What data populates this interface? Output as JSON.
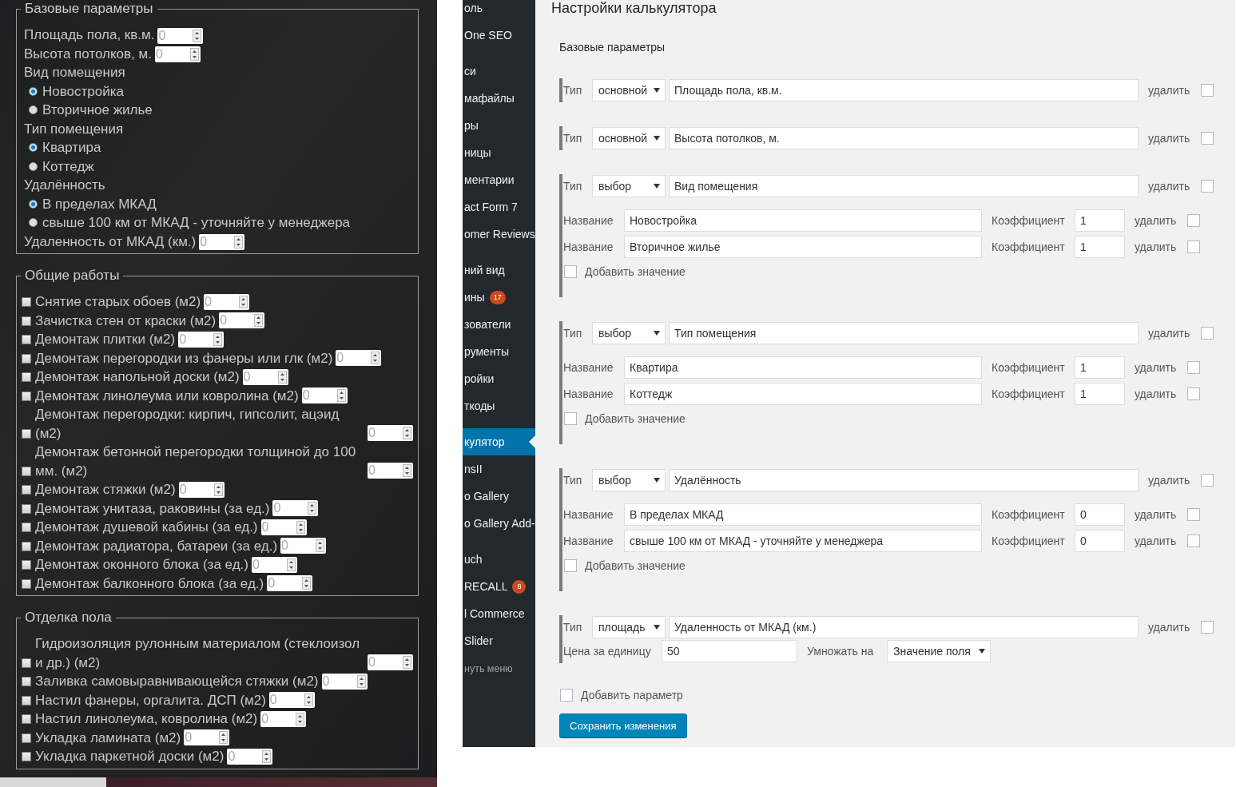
{
  "calculator_form": {
    "sections": [
      {
        "legend": "Базовые параметры",
        "items": [
          {
            "kind": "number",
            "label": "Площадь пола, кв.м.",
            "value": "0"
          },
          {
            "kind": "number",
            "label": "Высота потолков, м.",
            "value": "0"
          },
          {
            "kind": "heading",
            "label": "Вид помещения"
          },
          {
            "kind": "radio",
            "label": "Новостройка",
            "selected": true
          },
          {
            "kind": "radio",
            "label": "Вторичное жилье",
            "selected": false
          },
          {
            "kind": "heading",
            "label": "Тип помещения"
          },
          {
            "kind": "radio",
            "label": "Квартира",
            "selected": true
          },
          {
            "kind": "radio",
            "label": "Коттедж",
            "selected": false
          },
          {
            "kind": "heading",
            "label": "Удалённость"
          },
          {
            "kind": "radio",
            "label": "В пределах МКАД",
            "selected": true
          },
          {
            "kind": "radio",
            "label": "свыше 100 км от МКАД - уточняйте у менеджера",
            "selected": false
          },
          {
            "kind": "number",
            "label": "Удаленность от МКАД (км.)",
            "value": "0"
          }
        ]
      },
      {
        "legend": "Общие работы",
        "items": [
          {
            "kind": "check",
            "label": "Снятие старых обоев (м2)",
            "checked": false,
            "value": "0"
          },
          {
            "kind": "check",
            "label": "Зачистка стен от краски (м2)",
            "checked": false,
            "value": "0"
          },
          {
            "kind": "check",
            "label": "Демонтаж плитки (м2)",
            "checked": false,
            "value": "0"
          },
          {
            "kind": "check",
            "label": "Демонтаж перегородки из фанеры или глк (м2)",
            "checked": false,
            "value": "0"
          },
          {
            "kind": "check",
            "label": "Демонтаж напольной доски (м2)",
            "checked": false,
            "value": "0"
          },
          {
            "kind": "check",
            "label": "Демонтаж линолеума или ковролина (м2)",
            "checked": false,
            "value": "0"
          },
          {
            "kind": "check",
            "label": "Демонтаж перегородки: кирпич, гипсолит, ацэид (м2)",
            "checked": false,
            "value": "0"
          },
          {
            "kind": "check",
            "label": "Демонтаж бетонной перегородки толщиной до 100 мм. (м2)",
            "checked": false,
            "value": "0"
          },
          {
            "kind": "check",
            "label": "Демонтаж стяжки (м2)",
            "checked": false,
            "value": "0"
          },
          {
            "kind": "check",
            "label": "Демонтаж унитаза, раковины (за ед.)",
            "checked": false,
            "value": "0"
          },
          {
            "kind": "check",
            "label": "Демонтаж душевой кабины (за ед.)",
            "checked": false,
            "value": "0"
          },
          {
            "kind": "check",
            "label": "Демонтаж радиатора, батареи (за ед.)",
            "checked": false,
            "value": "0"
          },
          {
            "kind": "check",
            "label": "Демонтаж оконного блока (за ед.)",
            "checked": false,
            "value": "0"
          },
          {
            "kind": "check",
            "label": "Демонтаж балконного блока (за ед.)",
            "checked": false,
            "value": "0"
          }
        ]
      },
      {
        "legend": "Отделка пола",
        "items": [
          {
            "kind": "check",
            "label": "Гидроизоляция рулонным материалом (стеклоизол и др.) (м2)",
            "checked": false,
            "value": "0"
          },
          {
            "kind": "check",
            "label": "Заливка самовыравнивающейся стяжки (м2)",
            "checked": false,
            "value": "0"
          },
          {
            "kind": "check",
            "label": "Настил фанеры, оргалита. ДСП (м2)",
            "checked": false,
            "value": "0"
          },
          {
            "kind": "check",
            "label": "Настил линолеума, ковролина (м2)",
            "checked": false,
            "value": "0"
          },
          {
            "kind": "check",
            "label": "Укладка ламината (м2)",
            "checked": false,
            "value": "0"
          },
          {
            "kind": "check",
            "label": "Укладка паркетной доски (м2)",
            "checked": false,
            "value": "0"
          }
        ]
      }
    ]
  },
  "admin_sidebar": {
    "groups": [
      {
        "items": [
          {
            "label": "оль",
            "selected": false
          },
          {
            "label": "One SEO",
            "selected": false
          }
        ]
      },
      {
        "items": [
          {
            "label": "си",
            "selected": false
          },
          {
            "label": "мафайлы",
            "selected": false
          },
          {
            "label": "ры",
            "selected": false
          },
          {
            "label": "ницы",
            "selected": false
          },
          {
            "label": "ментарии",
            "selected": false
          },
          {
            "label": "act Form 7",
            "selected": false
          },
          {
            "label": "omer Reviews",
            "selected": false
          }
        ]
      },
      {
        "items": [
          {
            "label": "ний вид",
            "selected": false
          },
          {
            "label": "ины",
            "selected": false,
            "badge": "17"
          },
          {
            "label": "зователи",
            "selected": false
          },
          {
            "label": "рументы",
            "selected": false
          },
          {
            "label": "ройки",
            "selected": false
          },
          {
            "label": "ткоды",
            "selected": false
          }
        ]
      },
      {
        "items": [
          {
            "label": "кулятор",
            "selected": true
          },
          {
            "label": "nsII",
            "selected": false
          },
          {
            "label": "o Gallery",
            "selected": false
          },
          {
            "label": "o Gallery Add-",
            "selected": false
          }
        ]
      },
      {
        "items": [
          {
            "label": "uch",
            "selected": false
          },
          {
            "label": "RECALL",
            "selected": false,
            "badge": "8"
          },
          {
            "label": "l Commerce",
            "selected": false
          },
          {
            "label": "Slider",
            "selected": false
          }
        ]
      }
    ],
    "collapse_label": "нуть меню"
  },
  "settings_page": {
    "title": "Настройки калькулятора",
    "section_title": "Базовые параметры",
    "parameters": [
      {
        "kind": "basic",
        "type_label": "Тип",
        "type": "основной",
        "name": "Площадь пола, кв.м.",
        "delete_label": "удалить",
        "delete": false
      },
      {
        "kind": "basic",
        "type_label": "Тип",
        "type": "основной",
        "name": "Высота потолков, м.",
        "delete_label": "удалить",
        "delete": false
      },
      {
        "kind": "choice",
        "type_label": "Тип",
        "type": "выбор",
        "name": "Вид помещения",
        "delete_label": "удалить",
        "delete": false,
        "options": [
          {
            "name_label": "Название",
            "name": "Новостройка",
            "coefficient_label": "Коэффициент",
            "coefficient": "1",
            "delete_label": "удалить",
            "delete": false
          },
          {
            "name_label": "Название",
            "name": "Вторичное жилье",
            "coefficient_label": "Коэффициент",
            "coefficient": "1",
            "delete_label": "удалить",
            "delete": false
          }
        ],
        "add_value": {
          "label": "Добавить значение",
          "checked": false
        }
      },
      {
        "kind": "choice",
        "type_label": "Тип",
        "type": "выбор",
        "name": "Тип помещения",
        "delete_label": "удалить",
        "delete": false,
        "options": [
          {
            "name_label": "Название",
            "name": "Квартира",
            "coefficient_label": "Коэффициент",
            "coefficient": "1",
            "delete_label": "удалить",
            "delete": false
          },
          {
            "name_label": "Название",
            "name": "Коттедж",
            "coefficient_label": "Коэффициент",
            "coefficient": "1",
            "delete_label": "удалить",
            "delete": false
          }
        ],
        "add_value": {
          "label": "Добавить значение",
          "checked": false
        }
      },
      {
        "kind": "choice",
        "type_label": "Тип",
        "type": "выбор",
        "name": "Удалённость",
        "delete_label": "удалить",
        "delete": false,
        "options": [
          {
            "name_label": "Название",
            "name": "В пределах МКАД",
            "coefficient_label": "Коэффициент",
            "coefficient": "0",
            "delete_label": "удалить",
            "delete": false
          },
          {
            "name_label": "Название",
            "name": "свыше 100 км от МКАД - уточняйте у менеджера",
            "coefficient_label": "Коэффициент",
            "coefficient": "0",
            "delete_label": "удалить",
            "delete": false
          }
        ],
        "add_value": {
          "label": "Добавить значение",
          "checked": false
        }
      },
      {
        "kind": "area",
        "type_label": "Тип",
        "type": "площадь",
        "name": "Удаленность от МКАД (км.)",
        "delete_label": "удалить",
        "delete": false,
        "price_label": "Цена за единицу",
        "price": "50",
        "multiply_label": "Умножать на",
        "multiply_by": "Значение поля"
      }
    ],
    "add_parameter": {
      "label": "Добавить параметр",
      "checked": false
    },
    "save_button": "Сохранить изменения"
  }
}
